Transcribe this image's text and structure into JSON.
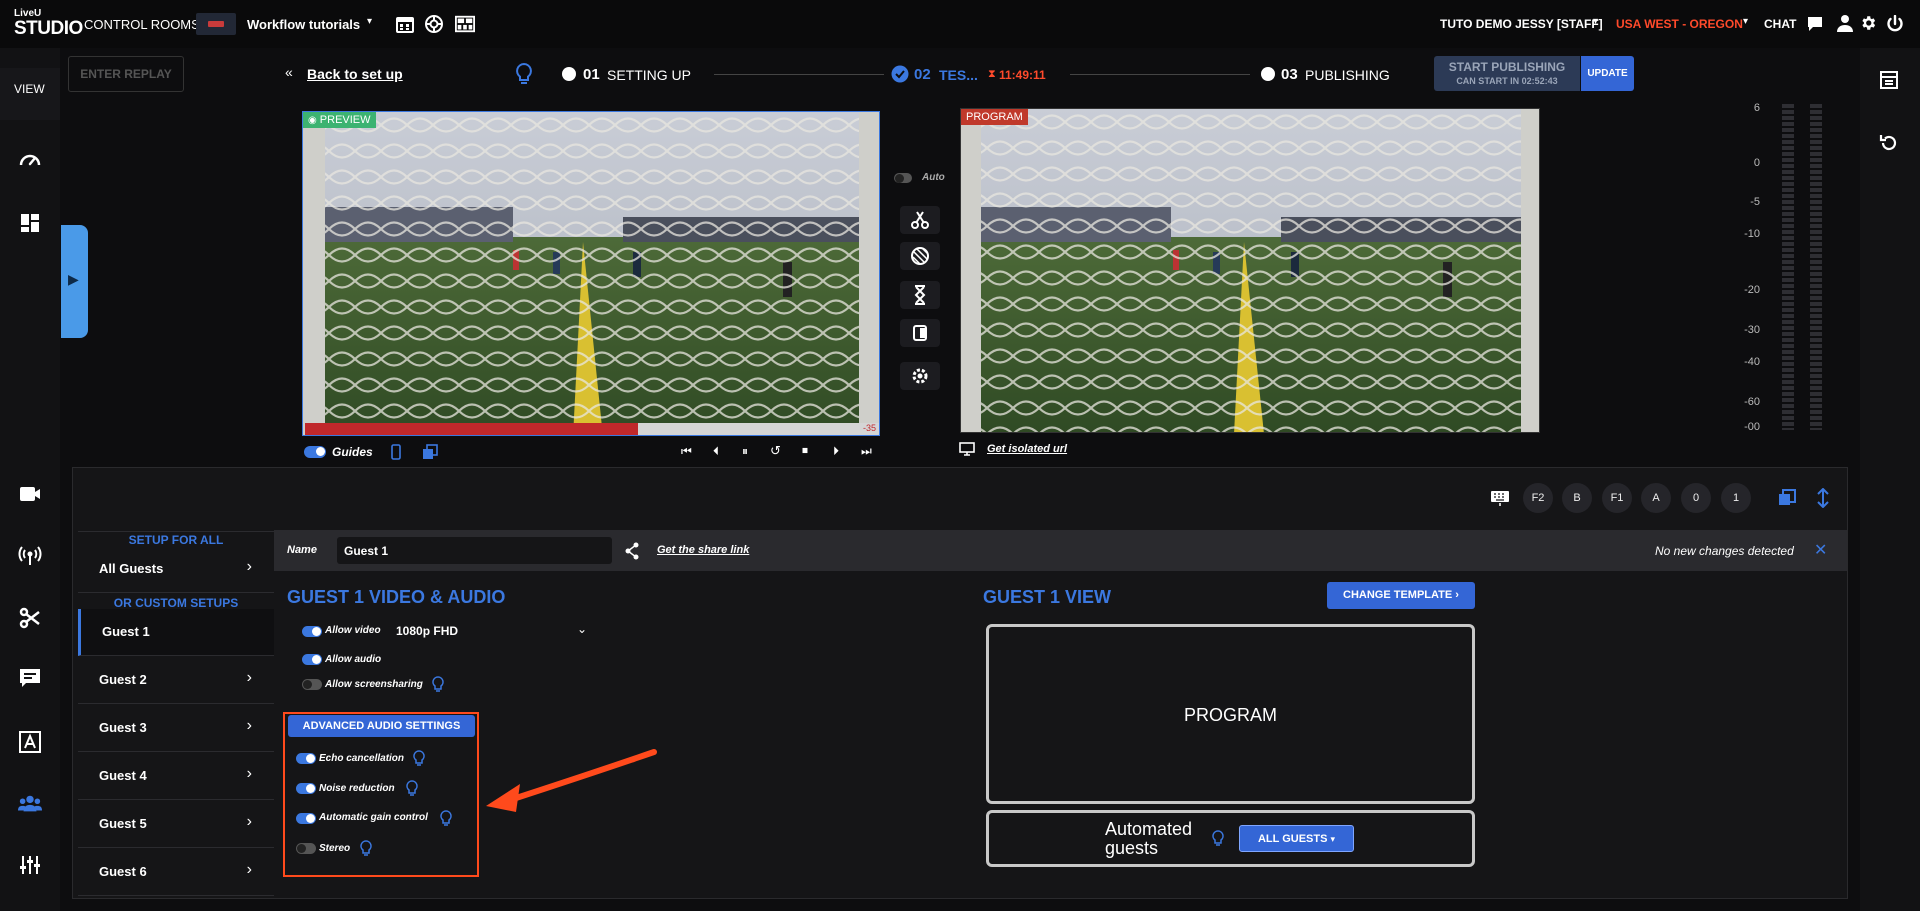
{
  "app": {
    "logo_top": "LiveU",
    "logo_bottom": "STUDIO"
  },
  "topbar": {
    "control_rooms": "CONTROL ROOMS",
    "workflow": "Workflow tutorials",
    "user": "TUTO DEMO JESSY [STAFF]",
    "region": "USA WEST - OREGON",
    "chat": "CHAT"
  },
  "sidebar": {
    "view_label": "VIEW"
  },
  "header": {
    "enter_replay": "ENTER REPLAY",
    "back_link": "Back to set up",
    "step1_num": "01",
    "step1_label": "SETTING UP",
    "step2_num": "02",
    "step2_label": "TES...",
    "timer": "11:49:11",
    "step3_num": "03",
    "step3_label": "PUBLISHING",
    "start_publishing": "START PUBLISHING",
    "can_start": "CAN START IN 02:52:43",
    "update": "UPDATE"
  },
  "preview": {
    "badge": "PREVIEW",
    "guides": "Guides",
    "remaining": "-35"
  },
  "program": {
    "badge": "PROGRAM",
    "isolated_url": "Get isolated url"
  },
  "controls": {
    "auto_label": "Auto"
  },
  "meter": {
    "scale": [
      "6",
      "0",
      "-5",
      "-10",
      "-20",
      "-30",
      "-40",
      "-60",
      "-00"
    ]
  },
  "toolbar": {
    "keys": [
      "F2",
      "B",
      "F1",
      "A",
      "0",
      "1"
    ]
  },
  "guests": {
    "setup_for_all": "SETUP FOR ALL",
    "all_guests": "All Guests",
    "custom_setups": "OR CUSTOM SETUPS",
    "list": [
      "Guest 1",
      "Guest 2",
      "Guest 3",
      "Guest 4",
      "Guest 5",
      "Guest 6"
    ]
  },
  "namebar": {
    "name_label": "Name",
    "name_value": "Guest 1",
    "share_link": "Get the share link",
    "status": "No new changes detected"
  },
  "video_audio": {
    "title": "GUEST 1 VIDEO & AUDIO",
    "allow_video": "Allow video",
    "resolution": "1080p FHD",
    "allow_audio": "Allow audio",
    "allow_screensharing": "Allow screensharing"
  },
  "advanced_audio": {
    "title": "ADVANCED AUDIO SETTINGS",
    "echo": "Echo cancellation",
    "noise": "Noise reduction",
    "agc": "Automatic gain control",
    "stereo": "Stereo"
  },
  "guest_view": {
    "title": "GUEST 1 VIEW",
    "change_template": "CHANGE TEMPLATE",
    "program_box": "PROGRAM",
    "automated_line1": "Automated",
    "automated_line2": "guests",
    "all_guests_btn": "ALL GUESTS"
  },
  "colors": {
    "accent": "#3b78e0",
    "region": "#ff4a2b",
    "highlight": "#ff4a1c",
    "preview_green": "#3cb371",
    "program_red": "#c0392b"
  }
}
